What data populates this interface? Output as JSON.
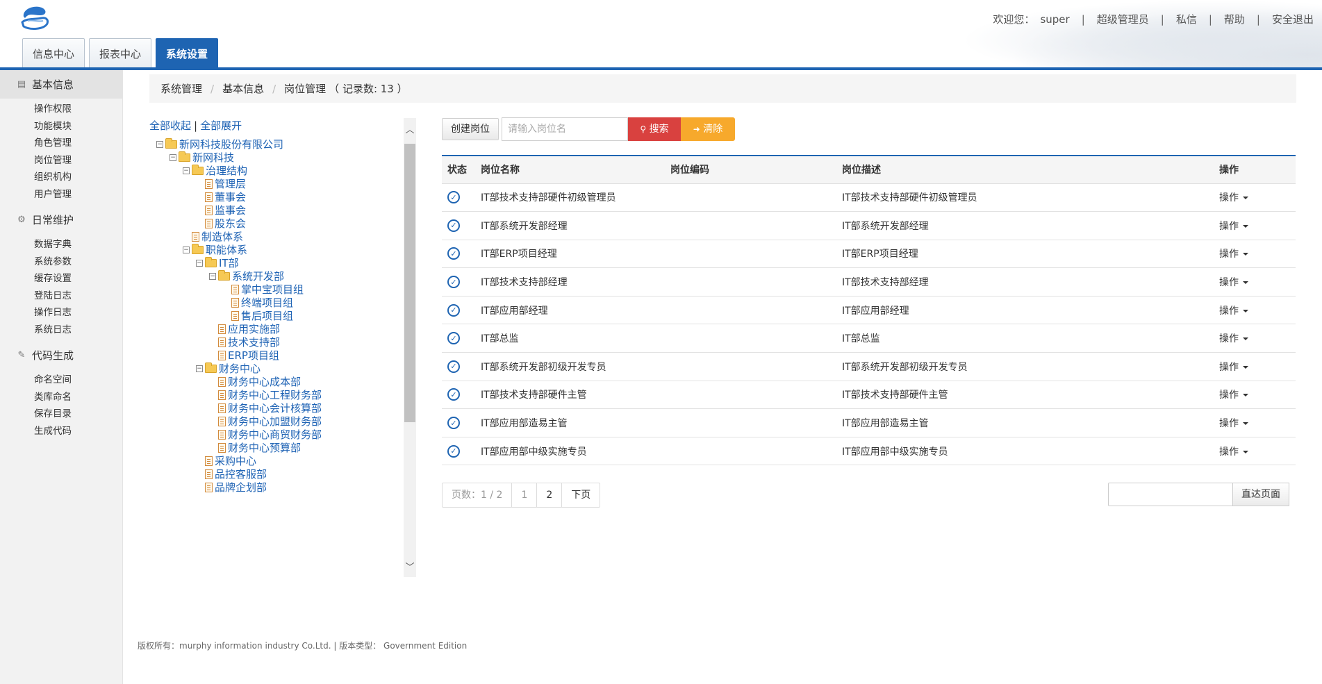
{
  "header": {
    "welcome_label": "欢迎您：",
    "username": "super",
    "links": [
      "超级管理员",
      "私信",
      "帮助",
      "安全退出"
    ],
    "tabs": [
      "信息中心",
      "报表中心",
      "系统设置"
    ],
    "active_tab": "系统设置"
  },
  "sidebar": {
    "groups": [
      {
        "title": "基本信息",
        "icon": "list-icon",
        "items": [
          "操作权限",
          "功能模块",
          "角色管理",
          "岗位管理",
          "组织机构",
          "用户管理"
        ]
      },
      {
        "title": "日常维护",
        "icon": "gear-icon",
        "items": [
          "数据字典",
          "系统参数",
          "缓存设置",
          "登陆日志",
          "操作日志",
          "系统日志"
        ]
      },
      {
        "title": "代码生成",
        "icon": "pencil-icon",
        "items": [
          "命名空间",
          "类库命名",
          "保存目录",
          "生成代码"
        ]
      }
    ]
  },
  "breadcrumb": {
    "items": [
      "系统管理",
      "基本信息",
      "岗位管理"
    ],
    "record_count": "（ 记录数: 13 ）"
  },
  "tree": {
    "collapse_all": "全部收起",
    "expand_all": "全部展开",
    "separator": "|",
    "nodes": [
      {
        "label": "新网科技股份有限公司",
        "level": 0,
        "type": "folder",
        "toggle": true
      },
      {
        "label": "新网科技",
        "level": 1,
        "type": "folder",
        "toggle": true
      },
      {
        "label": "治理结构",
        "level": 2,
        "type": "folder",
        "toggle": true
      },
      {
        "label": "管理层",
        "level": 3,
        "type": "file"
      },
      {
        "label": "董事会",
        "level": 3,
        "type": "file"
      },
      {
        "label": "监事会",
        "level": 3,
        "type": "file"
      },
      {
        "label": "股东会",
        "level": 3,
        "type": "file"
      },
      {
        "label": "制造体系",
        "level": 2,
        "type": "file"
      },
      {
        "label": "职能体系",
        "level": 2,
        "type": "folder",
        "toggle": true
      },
      {
        "label": "IT部",
        "level": 3,
        "type": "folder",
        "toggle": true
      },
      {
        "label": "系统开发部",
        "level": 4,
        "type": "folder",
        "toggle": true
      },
      {
        "label": "掌中宝项目组",
        "level": 5,
        "type": "file"
      },
      {
        "label": "终端项目组",
        "level": 5,
        "type": "file"
      },
      {
        "label": "售后项目组",
        "level": 5,
        "type": "file"
      },
      {
        "label": "应用实施部",
        "level": 4,
        "type": "file"
      },
      {
        "label": "技术支持部",
        "level": 4,
        "type": "file"
      },
      {
        "label": "ERP项目组",
        "level": 4,
        "type": "file"
      },
      {
        "label": "财务中心",
        "level": 3,
        "type": "folder",
        "toggle": true
      },
      {
        "label": "财务中心成本部",
        "level": 4,
        "type": "file"
      },
      {
        "label": "财务中心工程财务部",
        "level": 4,
        "type": "file"
      },
      {
        "label": "财务中心会计核算部",
        "level": 4,
        "type": "file"
      },
      {
        "label": "财务中心加盟财务部",
        "level": 4,
        "type": "file"
      },
      {
        "label": "财务中心商贸财务部",
        "level": 4,
        "type": "file"
      },
      {
        "label": "财务中心预算部",
        "level": 4,
        "type": "file"
      },
      {
        "label": "采购中心",
        "level": 3,
        "type": "file"
      },
      {
        "label": "品控客服部",
        "level": 3,
        "type": "file"
      },
      {
        "label": "品牌企划部",
        "level": 3,
        "type": "file"
      }
    ]
  },
  "toolbar": {
    "create_label": "创建岗位",
    "search_placeholder": "请输入岗位名",
    "search_label": "搜索",
    "clear_label": "清除"
  },
  "table": {
    "columns": [
      "状态",
      "岗位名称",
      "岗位编码",
      "岗位描述",
      "操作"
    ],
    "rows": [
      {
        "name": "IT部技术支持部硬件初级管理员",
        "code": "",
        "desc": "IT部技术支持部硬件初级管理员",
        "op": "操作"
      },
      {
        "name": "IT部系统开发部经理",
        "code": "",
        "desc": "IT部系统开发部经理",
        "op": "操作"
      },
      {
        "name": "IT部ERP项目经理",
        "code": "",
        "desc": "IT部ERP项目经理",
        "op": "操作"
      },
      {
        "name": "IT部技术支持部经理",
        "code": "",
        "desc": "IT部技术支持部经理",
        "op": "操作"
      },
      {
        "name": "IT部应用部经理",
        "code": "",
        "desc": "IT部应用部经理",
        "op": "操作"
      },
      {
        "name": "IT部总监",
        "code": "",
        "desc": "IT部总监",
        "op": "操作"
      },
      {
        "name": "IT部系统开发部初级开发专员",
        "code": "",
        "desc": "IT部系统开发部初级开发专员",
        "op": "操作"
      },
      {
        "name": "IT部技术支持部硬件主管",
        "code": "",
        "desc": "IT部技术支持部硬件主管",
        "op": "操作"
      },
      {
        "name": "IT部应用部造易主管",
        "code": "",
        "desc": "IT部应用部造易主管",
        "op": "操作"
      },
      {
        "name": "IT部应用部中级实施专员",
        "code": "",
        "desc": "IT部应用部中级实施专员",
        "op": "操作"
      }
    ]
  },
  "pagination": {
    "info": "页数：1 / 2",
    "pages": [
      "1",
      "2"
    ],
    "next_label": "下页",
    "goto_label": "直达页面",
    "goto_value": ""
  },
  "footer": {
    "text": "版权所有：murphy information industry Co.Ltd. | 版本类型： Government Edition"
  },
  "colors": {
    "primary": "#1e64b2",
    "search_button": "#d9413f",
    "clear_button": "#f7a92c",
    "tree_link": "#1d62b4"
  }
}
